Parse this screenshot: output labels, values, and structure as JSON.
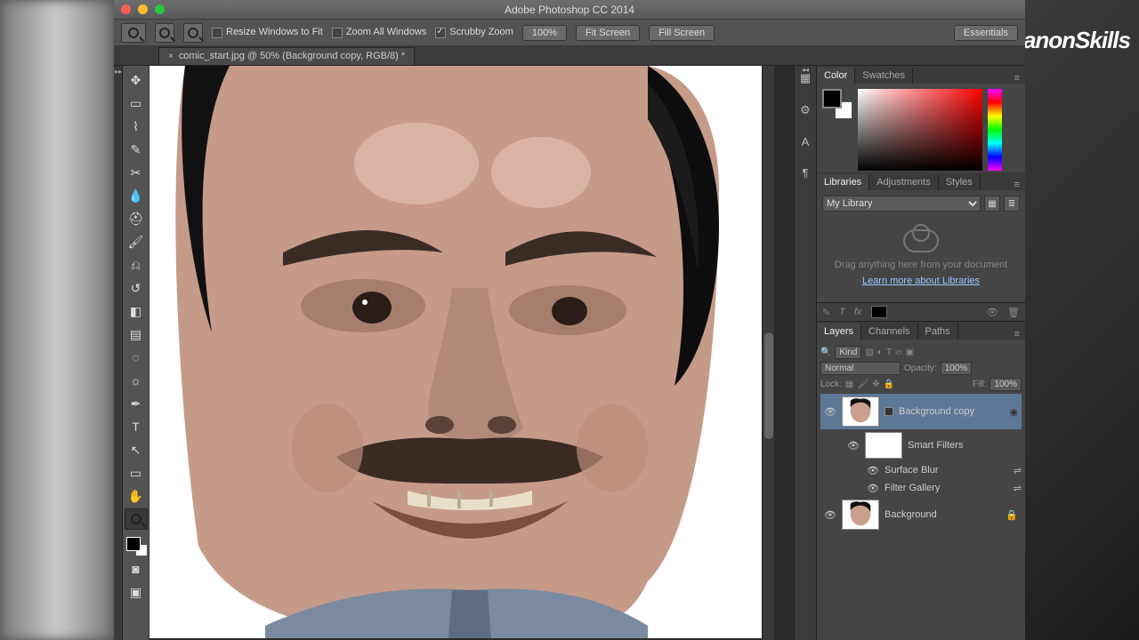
{
  "window": {
    "title": "Adobe Photoshop CC 2014"
  },
  "options": {
    "resize_windows": "Resize Windows to Fit",
    "zoom_all": "Zoom All Windows",
    "scrubby": "Scrubby Zoom",
    "zoom_pct": "100%",
    "fit": "Fit Screen",
    "fill": "Fill Screen",
    "workspace": "Essentials"
  },
  "tab": {
    "label": "comic_start.jpg @ 50% (Background copy, RGB/8) *"
  },
  "panels": {
    "color": "Color",
    "swatches": "Swatches",
    "libraries": "Libraries",
    "adjustments": "Adjustments",
    "styles": "Styles",
    "layers": "Layers",
    "channels": "Channels",
    "paths": "Paths"
  },
  "libraries": {
    "select": "My Library",
    "empty": "Drag anything here from your document",
    "link": "Learn more about Libraries"
  },
  "layers": {
    "kind": "Kind",
    "blend": "Normal",
    "opacity_l": "Opacity:",
    "opacity_v": "100%",
    "fill_l": "Fill:",
    "fill_v": "100%",
    "lock_l": "Lock:",
    "items": {
      "bg_copy": "Background copy",
      "smart": "Smart Filters",
      "surface": "Surface Blur",
      "gallery": "Filter Gallery",
      "bg": "Background"
    }
  },
  "brand": "CanonSkills"
}
